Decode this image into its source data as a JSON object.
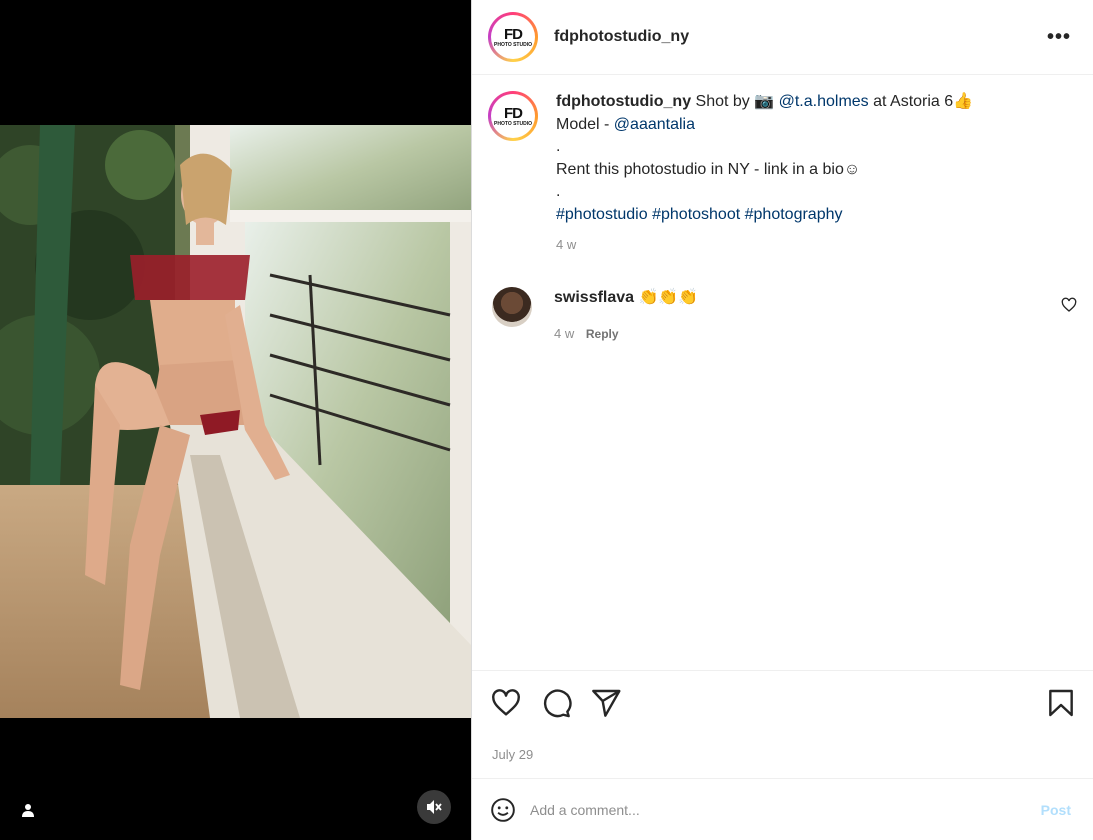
{
  "post": {
    "username": "fdphotostudio_ny",
    "avatar_logo": {
      "big": "FD",
      "small": "PHOTO STUDIO"
    },
    "more_label": "•••",
    "caption": {
      "username": "fdphotostudio_ny",
      "text_1": " Shot by 📷  ",
      "mention_1": "@t.a.holmes",
      "text_2": " at Astoria 6👍",
      "line_2_prefix": "Model - ",
      "mention_2": "@aaantalia",
      "dot_1": ".",
      "line_4": "Rent this photostudio in NY - link in a bio☺",
      "dot_2": ".",
      "hashtags": [
        "#photostudio",
        "#photoshoot",
        "#photography"
      ],
      "age": "4 w"
    },
    "comments": [
      {
        "username": "swissflava",
        "text": " 👏👏👏",
        "age": "4 w",
        "reply_label": "Reply"
      }
    ],
    "date": "July 29",
    "add_comment": {
      "placeholder": "Add a comment...",
      "post_label": "Post"
    }
  },
  "icons": {
    "like": "heart-icon",
    "comment": "comment-bubble-icon",
    "share": "paper-plane-icon",
    "save": "bookmark-icon",
    "emoji": "smiley-icon",
    "tags": "user-icon",
    "mute": "speaker-muted-icon"
  },
  "colors": {
    "link": "#00376b",
    "muted": "#8e8e8e",
    "post_disabled": "#b2dffc"
  }
}
